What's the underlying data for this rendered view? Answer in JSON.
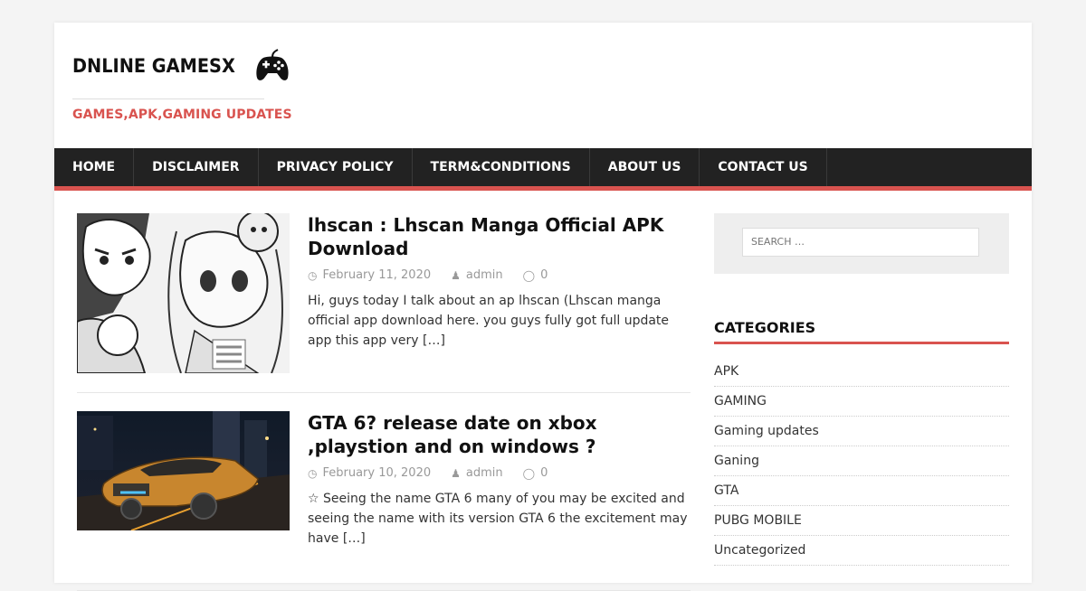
{
  "site": {
    "logo_text": "DNLINE GAMESX",
    "tagline": "GAMES,APK,GAMING UPDATES"
  },
  "nav": {
    "items": [
      {
        "label": "HOME"
      },
      {
        "label": "DISCLAIMER"
      },
      {
        "label": "PRIVACY POLICY"
      },
      {
        "label": "TERM&CONDITIONS"
      },
      {
        "label": "ABOUT US"
      },
      {
        "label": "CONTACT US"
      }
    ]
  },
  "posts": [
    {
      "title": "lhscan : Lhscan Manga Official APK Download",
      "date": "February 11, 2020",
      "author": "admin",
      "comments": "0",
      "excerpt": "Hi, guys today I talk about an ap lhscan (Lhscan manga official app download here. you guys fully got full update app this app very",
      "more": "[…]"
    },
    {
      "title": "GTA 6? release date on xbox ,playstion and on windows ?",
      "date": "February 10, 2020",
      "author": "admin",
      "comments": "0",
      "excerpt": "☆ Seeing the name GTA 6 many of you may be excited and seeing the name with its version GTA 6 the excitement may have",
      "more": "[…]"
    }
  ],
  "sidebar": {
    "search_placeholder": "SEARCH …",
    "categories_title": "CATEGORIES",
    "categories": [
      {
        "label": "APK"
      },
      {
        "label": "GAMING"
      },
      {
        "label": "Gaming updates"
      },
      {
        "label": "Ganing"
      },
      {
        "label": "GTA"
      },
      {
        "label": "PUBG MOBILE"
      },
      {
        "label": "Uncategorized"
      }
    ]
  },
  "icons": {
    "logo": "gamepad-icon",
    "date": "clock-icon",
    "author": "user-icon",
    "comments": "comment-icon"
  },
  "colors": {
    "accent": "#d9534f",
    "nav_bg": "#222222"
  }
}
